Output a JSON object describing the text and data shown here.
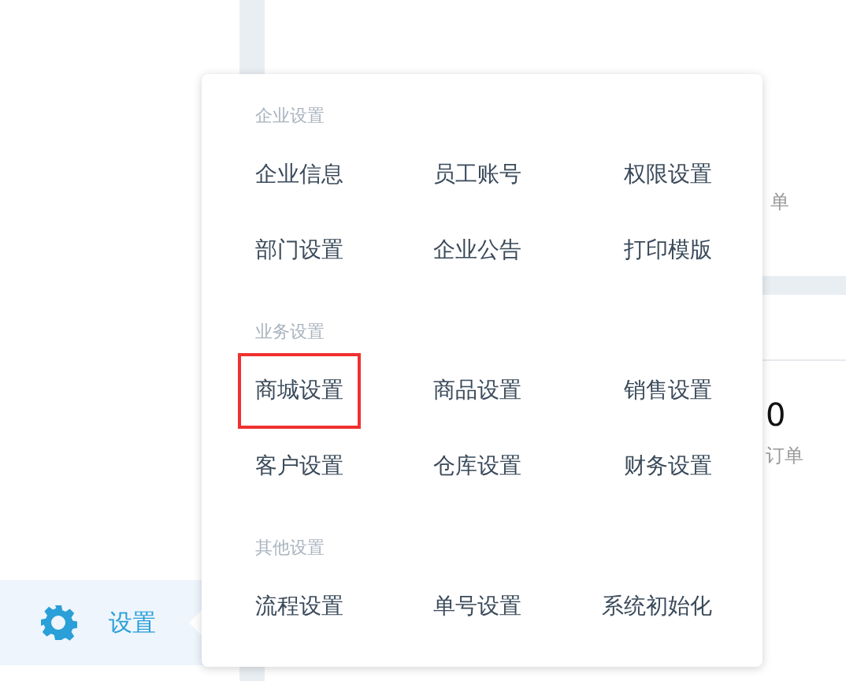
{
  "sidebar": {
    "items": [
      {
        "label": "设置",
        "selected": true
      }
    ]
  },
  "background": {
    "card_1": {
      "caption": "单"
    },
    "card_2": {
      "value": "0",
      "caption": "订单"
    }
  },
  "settings_menu": {
    "sections": [
      {
        "title": "企业设置",
        "items": [
          {
            "label": "企业信息",
            "highlighted": false
          },
          {
            "label": "员工账号",
            "highlighted": false
          },
          {
            "label": "权限设置",
            "highlighted": false
          },
          {
            "label": "部门设置",
            "highlighted": false
          },
          {
            "label": "企业公告",
            "highlighted": false
          },
          {
            "label": "打印模版",
            "highlighted": false
          }
        ]
      },
      {
        "title": "业务设置",
        "items": [
          {
            "label": "商城设置",
            "highlighted": true
          },
          {
            "label": "商品设置",
            "highlighted": false
          },
          {
            "label": "销售设置",
            "highlighted": false
          },
          {
            "label": "客户设置",
            "highlighted": false
          },
          {
            "label": "仓库设置",
            "highlighted": false
          },
          {
            "label": "财务设置",
            "highlighted": false
          }
        ]
      },
      {
        "title": "其他设置",
        "items": [
          {
            "label": "流程设置",
            "highlighted": false
          },
          {
            "label": "单号设置",
            "highlighted": false
          },
          {
            "label": "系统初始化",
            "highlighted": false
          }
        ]
      }
    ]
  }
}
